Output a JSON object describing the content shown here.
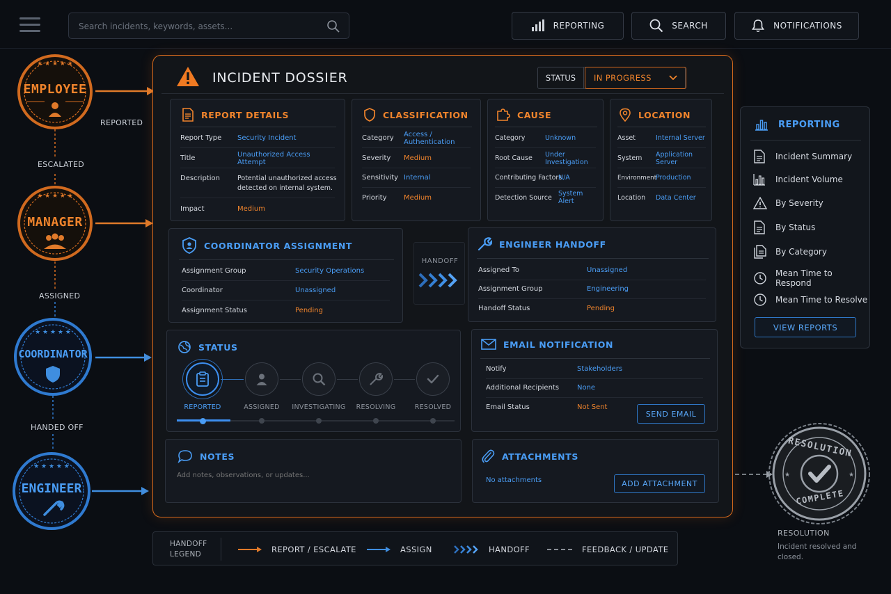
{
  "topbar": {
    "search_placeholder": "Search incidents, keywords, assets...",
    "buttons": [
      {
        "label": "REPORTING",
        "icon": "bar-chart-icon"
      },
      {
        "label": "SEARCH",
        "icon": "search-icon"
      },
      {
        "label": "NOTIFICATIONS",
        "icon": "bell-icon"
      }
    ]
  },
  "flow": {
    "roles": [
      "EMPLOYEE",
      "MANAGER",
      "COORDINATOR",
      "ENGINEER"
    ],
    "labels": [
      "REPORTED",
      "ESCALATED",
      "ASSIGNED",
      "HANDED OFF"
    ]
  },
  "dossier": {
    "title": "INCIDENT DOSSIER",
    "status_label": "STATUS",
    "status_value": "IN PROGRESS",
    "report_details": {
      "title": "REPORT DETAILS",
      "rows": [
        {
          "k": "Report Type",
          "v": "Security Incident"
        },
        {
          "k": "Title",
          "v": "Unauthorized Access Attempt"
        },
        {
          "k": "Description",
          "v": "Potential unauthorized access detected on internal system."
        },
        {
          "k": "Impact",
          "v": "Medium"
        }
      ]
    },
    "classification": {
      "title": "CLASSIFICATION",
      "rows": [
        {
          "k": "Category",
          "v": "Access / Authentication"
        },
        {
          "k": "Severity",
          "v": "Medium"
        },
        {
          "k": "Sensitivity",
          "v": "Internal"
        },
        {
          "k": "Priority",
          "v": "Medium"
        }
      ]
    },
    "cause": {
      "title": "CAUSE",
      "rows": [
        {
          "k": "Category",
          "v": "Unknown"
        },
        {
          "k": "Root Cause",
          "v": "Under Investigation"
        },
        {
          "k": "Contributing Factors",
          "v": "N/A"
        },
        {
          "k": "Detection Source",
          "v": "System Alert"
        }
      ]
    },
    "location": {
      "title": "LOCATION",
      "rows": [
        {
          "k": "Asset",
          "v": "Internal Server"
        },
        {
          "k": "System",
          "v": "Application Server"
        },
        {
          "k": "Environment",
          "v": "Production"
        },
        {
          "k": "Location",
          "v": "Data Center"
        }
      ]
    },
    "coordinator": {
      "title": "COORDINATOR ASSIGNMENT",
      "rows": [
        {
          "k": "Assignment Group",
          "v": "Security Operations"
        },
        {
          "k": "Coordinator",
          "v": "Unassigned"
        },
        {
          "k": "Assignment Status",
          "v": "Pending"
        }
      ]
    },
    "handoff_label": "HANDOFF",
    "engineer": {
      "title": "ENGINEER HANDOFF",
      "rows": [
        {
          "k": "Assigned To",
          "v": "Unassigned"
        },
        {
          "k": "Assignment Group",
          "v": "Engineering"
        },
        {
          "k": "Handoff Status",
          "v": "Pending"
        }
      ]
    },
    "status": {
      "title": "STATUS",
      "steps": [
        "REPORTED",
        "ASSIGNED",
        "INVESTIGATING",
        "RESOLVING",
        "RESOLVED"
      ],
      "current_step": 0
    },
    "email": {
      "title": "EMAIL NOTIFICATION",
      "rows": [
        {
          "k": "Notify",
          "v": "Stakeholders"
        },
        {
          "k": "Additional Recipients",
          "v": "None"
        },
        {
          "k": "Email Status",
          "v": "Not Sent"
        }
      ],
      "button": "SEND EMAIL"
    },
    "notes": {
      "title": "NOTES",
      "placeholder": "Add notes, observations, or updates..."
    },
    "attachments": {
      "title": "ATTACHMENTS",
      "empty": "No attachments",
      "button": "ADD ATTACHMENT"
    }
  },
  "reporting": {
    "title": "REPORTING",
    "items": [
      {
        "label": "Incident Summary",
        "icon": "document-icon"
      },
      {
        "label": "Incident Volume",
        "icon": "bar-chart-icon"
      },
      {
        "label": "By Severity",
        "icon": "warning-icon"
      },
      {
        "label": "By Status",
        "icon": "document-icon"
      },
      {
        "label": "By Category",
        "icon": "documents-icon"
      },
      {
        "label": "Mean Time to Respond",
        "icon": "clock-icon"
      },
      {
        "label": "Mean Time to Resolve",
        "icon": "clock-icon"
      }
    ],
    "button": "VIEW REPORTS"
  },
  "resolution": {
    "stamp_top": "RESOLUTION",
    "stamp_bottom": "COMPLETE",
    "title": "RESOLUTION",
    "desc": "Incident resolved and closed."
  },
  "legend": {
    "title": "HANDOFF LEGEND",
    "items": [
      "REPORT / ESCALATE",
      "ASSIGN",
      "HANDOFF",
      "FEEDBACK / UPDATE"
    ]
  },
  "colors": {
    "orange": "#f0842c",
    "blue": "#4a9df5",
    "background": "#0b0e13"
  }
}
